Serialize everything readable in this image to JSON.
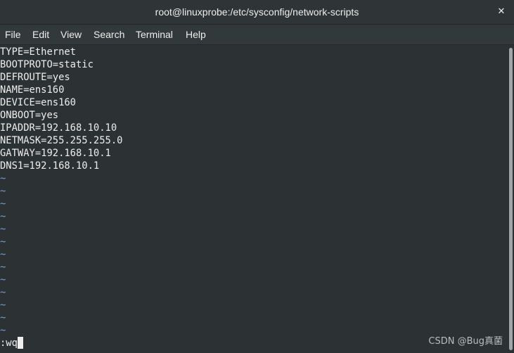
{
  "window": {
    "title": "root@linuxprobe:/etc/sysconfig/network-scripts",
    "close_glyph": "✕"
  },
  "menu": {
    "items": [
      "File",
      "Edit",
      "View",
      "Search",
      "Terminal",
      "Help"
    ]
  },
  "terminal": {
    "lines": [
      "TYPE=Ethernet",
      "BOOTPROTO=static",
      "DEFROUTE=yes",
      "NAME=ens160",
      "DEVICE=ens160",
      "ONBOOT=yes",
      "IPADDR=192.168.10.10",
      "NETMASK=255.255.255.0",
      "GATWAY=192.168.10.1",
      "DNS1=192.168.10.1"
    ],
    "empty_line_marker": "~",
    "empty_line_count": 13,
    "command_line": ":wq"
  },
  "watermark": "CSDN @Bug真菌",
  "colors": {
    "background": "#2c3134",
    "text": "#eeeeec",
    "tilde": "#729fcf"
  }
}
